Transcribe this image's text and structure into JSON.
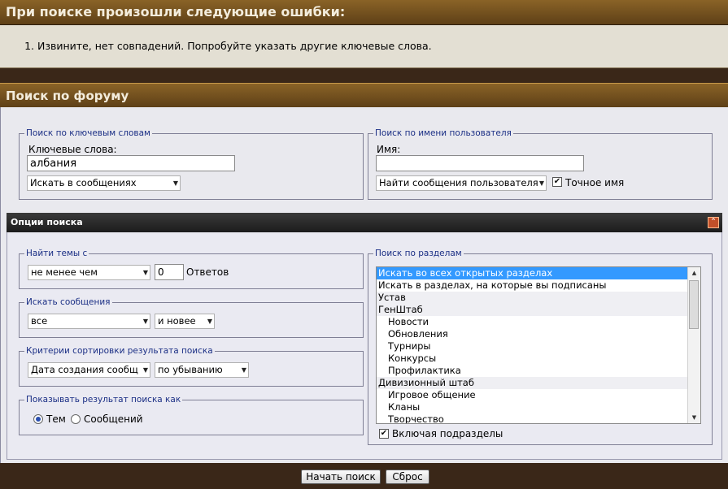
{
  "errors": {
    "title": "При поиске произошли следующие ошибки:",
    "items": [
      "Извините, нет совпадений. Попробуйте указать другие ключевые слова."
    ]
  },
  "search": {
    "title": "Поиск по форуму",
    "keywords_legend": "Поиск по ключевым словам",
    "keywords_label": "Ключевые слова:",
    "keywords_value": "албания",
    "keywords_scope": "Искать в сообщениях",
    "user_legend": "Поиск по имени пользователя",
    "name_label": "Имя:",
    "name_value": "",
    "user_mode": "Найти сообщения пользователя",
    "exact_name_label": "Точное имя",
    "exact_name_checked": true
  },
  "options": {
    "title": "Опции поиска",
    "topics_legend": "Найти темы с",
    "topics_cmp": "не менее чем",
    "topics_count": "0",
    "replies_label": "Ответов",
    "posts_legend": "Искать сообщения",
    "posts_period": "все",
    "posts_dir": "и новее",
    "sort_legend": "Критерии сортировки результата поиска",
    "sort_by": "Дата создания сообщ",
    "sort_order": "по убыванию",
    "show_legend": "Показывать результат поиска как",
    "show_topics": "Тем",
    "show_posts": "Сообщений",
    "forums_legend": "Поиск по разделам",
    "forums": [
      {
        "label": "Искать во всех открытых разделах",
        "level": 0,
        "selected": true
      },
      {
        "label": "Искать в разделах, на которые вы подписаны",
        "level": 0
      },
      {
        "label": "Устав",
        "level": 0,
        "cat": true
      },
      {
        "label": "ГенШтаб",
        "level": 0,
        "cat": true
      },
      {
        "label": "Новости",
        "level": 1
      },
      {
        "label": "Обновления",
        "level": 1
      },
      {
        "label": "Турниры",
        "level": 1
      },
      {
        "label": "Конкурсы",
        "level": 1
      },
      {
        "label": "Профилактика",
        "level": 1
      },
      {
        "label": "Дивизионный штаб",
        "level": 0,
        "cat": true
      },
      {
        "label": "Игровое общение",
        "level": 1
      },
      {
        "label": "Кланы",
        "level": 1
      },
      {
        "label": "Творчество",
        "level": 1
      }
    ],
    "include_sub_label": "Включая подразделы",
    "include_sub_checked": true
  },
  "buttons": {
    "start": "Начать поиск",
    "reset": "Сброс"
  }
}
